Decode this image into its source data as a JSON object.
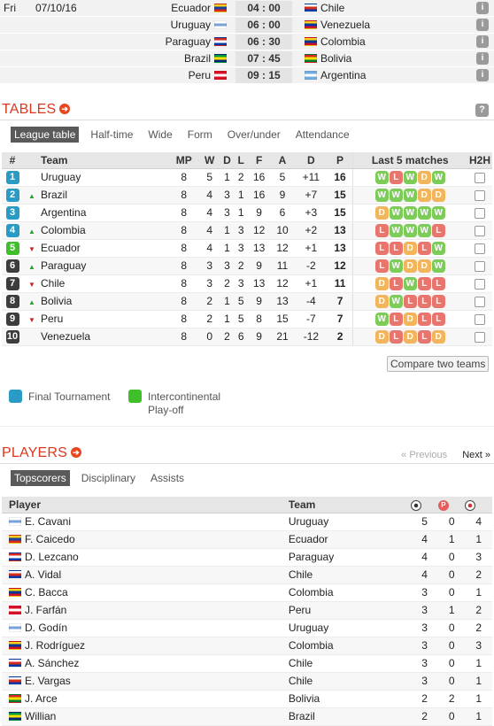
{
  "fixtures": {
    "day": "Fri",
    "date": "07/10/16",
    "matches": [
      {
        "home": "Ecuador",
        "home_flag": [
          "#f7d117",
          "#1a3fa0",
          "#d52b1e"
        ],
        "time": "04 : 00",
        "away": "Chile",
        "away_flag": [
          "#ffffff",
          "#d52b1e",
          "#0039a6"
        ]
      },
      {
        "home": "Uruguay",
        "home_flag": [
          "#ffffff",
          "#7ba2d6",
          "#ffffff"
        ],
        "time": "06 : 00",
        "away": "Venezuela",
        "away_flag": [
          "#f7d117",
          "#0033a0",
          "#cf142b"
        ]
      },
      {
        "home": "Paraguay",
        "home_flag": [
          "#d52b1e",
          "#ffffff",
          "#0038a8"
        ],
        "time": "06 : 30",
        "away": "Colombia",
        "away_flag": [
          "#fcd116",
          "#003893",
          "#ce1126"
        ]
      },
      {
        "home": "Brazil",
        "home_flag": [
          "#009c3b",
          "#ffdf00",
          "#002776"
        ],
        "time": "07 : 45",
        "away": "Bolivia",
        "away_flag": [
          "#d52b1e",
          "#f9e300",
          "#007934"
        ]
      },
      {
        "home": "Peru",
        "home_flag": [
          "#d91023",
          "#ffffff",
          "#d91023"
        ],
        "time": "09 : 15",
        "away": "Argentina",
        "away_flag": [
          "#74acdf",
          "#ffffff",
          "#74acdf"
        ]
      }
    ],
    "info_label": "i"
  },
  "tables": {
    "title": "TABLES",
    "help_label": "?",
    "tabs": [
      "League table",
      "Half-time",
      "Wide",
      "Form",
      "Over/under",
      "Attendance"
    ],
    "headers": {
      "pos": "#",
      "team": "Team",
      "mp": "MP",
      "w": "W",
      "d": "D",
      "l": "L",
      "f": "F",
      "a": "A",
      "gd": "D",
      "p": "P",
      "last5": "Last 5 matches",
      "h2h": "H2H"
    },
    "rows": [
      {
        "pos": "1",
        "zone": "blue",
        "trend": "",
        "team": "Uruguay",
        "mp": "8",
        "w": "5",
        "d": "1",
        "l": "2",
        "f": "16",
        "a": "5",
        "gd": "+11",
        "p": "16",
        "form": [
          "W",
          "L",
          "W",
          "D",
          "W"
        ]
      },
      {
        "pos": "2",
        "zone": "blue",
        "trend": "up",
        "team": "Brazil",
        "mp": "8",
        "w": "4",
        "d": "3",
        "l": "1",
        "f": "16",
        "a": "9",
        "gd": "+7",
        "p": "15",
        "form": [
          "W",
          "W",
          "W",
          "D",
          "D"
        ]
      },
      {
        "pos": "3",
        "zone": "blue",
        "trend": "",
        "team": "Argentina",
        "mp": "8",
        "w": "4",
        "d": "3",
        "l": "1",
        "f": "9",
        "a": "6",
        "gd": "+3",
        "p": "15",
        "form": [
          "D",
          "W",
          "W",
          "W",
          "W"
        ]
      },
      {
        "pos": "4",
        "zone": "blue",
        "trend": "up",
        "team": "Colombia",
        "mp": "8",
        "w": "4",
        "d": "1",
        "l": "3",
        "f": "12",
        "a": "10",
        "gd": "+2",
        "p": "13",
        "form": [
          "L",
          "W",
          "W",
          "W",
          "L"
        ]
      },
      {
        "pos": "5",
        "zone": "green",
        "trend": "down",
        "team": "Ecuador",
        "mp": "8",
        "w": "4",
        "d": "1",
        "l": "3",
        "f": "13",
        "a": "12",
        "gd": "+1",
        "p": "13",
        "form": [
          "L",
          "L",
          "D",
          "L",
          "W"
        ]
      },
      {
        "pos": "6",
        "zone": "dark",
        "trend": "up",
        "team": "Paraguay",
        "mp": "8",
        "w": "3",
        "d": "3",
        "l": "2",
        "f": "9",
        "a": "11",
        "gd": "-2",
        "p": "12",
        "form": [
          "L",
          "W",
          "D",
          "D",
          "W"
        ]
      },
      {
        "pos": "7",
        "zone": "dark",
        "trend": "down",
        "team": "Chile",
        "mp": "8",
        "w": "3",
        "d": "2",
        "l": "3",
        "f": "13",
        "a": "12",
        "gd": "+1",
        "p": "11",
        "form": [
          "D",
          "L",
          "W",
          "L",
          "L"
        ]
      },
      {
        "pos": "8",
        "zone": "dark",
        "trend": "up",
        "team": "Bolivia",
        "mp": "8",
        "w": "2",
        "d": "1",
        "l": "5",
        "f": "9",
        "a": "13",
        "gd": "-4",
        "p": "7",
        "form": [
          "D",
          "W",
          "L",
          "L",
          "L"
        ]
      },
      {
        "pos": "9",
        "zone": "dark",
        "trend": "down",
        "team": "Peru",
        "mp": "8",
        "w": "2",
        "d": "1",
        "l": "5",
        "f": "8",
        "a": "15",
        "gd": "-7",
        "p": "7",
        "form": [
          "W",
          "L",
          "D",
          "L",
          "L"
        ]
      },
      {
        "pos": "10",
        "zone": "dark",
        "trend": "",
        "team": "Venezuela",
        "mp": "8",
        "w": "0",
        "d": "2",
        "l": "6",
        "f": "9",
        "a": "21",
        "gd": "-12",
        "p": "2",
        "form": [
          "D",
          "L",
          "D",
          "L",
          "D"
        ]
      }
    ],
    "compare_label": "Compare two teams",
    "legend": [
      {
        "label": "Final Tournament",
        "color": "#2a9bc4"
      },
      {
        "label_line1": "Intercontinental",
        "label_line2": "Play-off",
        "color": "#3fbf2a"
      }
    ]
  },
  "players": {
    "title": "PLAYERS",
    "prev_label": "« Previous",
    "next_label": "Next »",
    "tabs": [
      "Topscorers",
      "Disciplinary",
      "Assists"
    ],
    "headers": {
      "player": "Player",
      "team": "Team"
    },
    "rows": [
      {
        "name": "E. Cavani",
        "team": "Uruguay",
        "goals": "5",
        "pens": "0",
        "third": "4"
      },
      {
        "name": "F. Caicedo",
        "team": "Ecuador",
        "goals": "4",
        "pens": "1",
        "third": "1"
      },
      {
        "name": "D. Lezcano",
        "team": "Paraguay",
        "goals": "4",
        "pens": "0",
        "third": "3"
      },
      {
        "name": "A. Vidal",
        "team": "Chile",
        "goals": "4",
        "pens": "0",
        "third": "2"
      },
      {
        "name": "C. Bacca",
        "team": "Colombia",
        "goals": "3",
        "pens": "0",
        "third": "1"
      },
      {
        "name": "J. Farfán",
        "team": "Peru",
        "goals": "3",
        "pens": "1",
        "third": "2"
      },
      {
        "name": "D. Godín",
        "team": "Uruguay",
        "goals": "3",
        "pens": "0",
        "third": "2"
      },
      {
        "name": "J. Rodríguez",
        "team": "Colombia",
        "goals": "3",
        "pens": "0",
        "third": "3"
      },
      {
        "name": "A. Sánchez",
        "team": "Chile",
        "goals": "3",
        "pens": "0",
        "third": "1"
      },
      {
        "name": "E. Vargas",
        "team": "Chile",
        "goals": "3",
        "pens": "0",
        "third": "1"
      },
      {
        "name": "J. Arce",
        "team": "Bolivia",
        "goals": "2",
        "pens": "2",
        "third": "1"
      },
      {
        "name": "Willian",
        "team": "Brazil",
        "goals": "2",
        "pens": "0",
        "third": "1"
      }
    ]
  },
  "colors": {
    "accent": "#d9381e",
    "zone_blue": "#2a9bc4",
    "zone_green": "#3fbf2a",
    "zone_dark": "#3d3d3d",
    "form_w": "#7dcc5a",
    "form_d": "#f3b55b",
    "form_l": "#e9756f"
  },
  "team_flags": {
    "Uruguay": [
      "#ffffff",
      "#7ba2d6",
      "#ffffff"
    ],
    "Ecuador": [
      "#f7d117",
      "#1a3fa0",
      "#d52b1e"
    ],
    "Paraguay": [
      "#d52b1e",
      "#ffffff",
      "#0038a8"
    ],
    "Chile": [
      "#ffffff",
      "#d52b1e",
      "#0039a6"
    ],
    "Colombia": [
      "#fcd116",
      "#003893",
      "#ce1126"
    ],
    "Peru": [
      "#d91023",
      "#ffffff",
      "#d91023"
    ],
    "Bolivia": [
      "#d52b1e",
      "#f9e300",
      "#007934"
    ],
    "Brazil": [
      "#009c3b",
      "#ffdf00",
      "#002776"
    ]
  }
}
